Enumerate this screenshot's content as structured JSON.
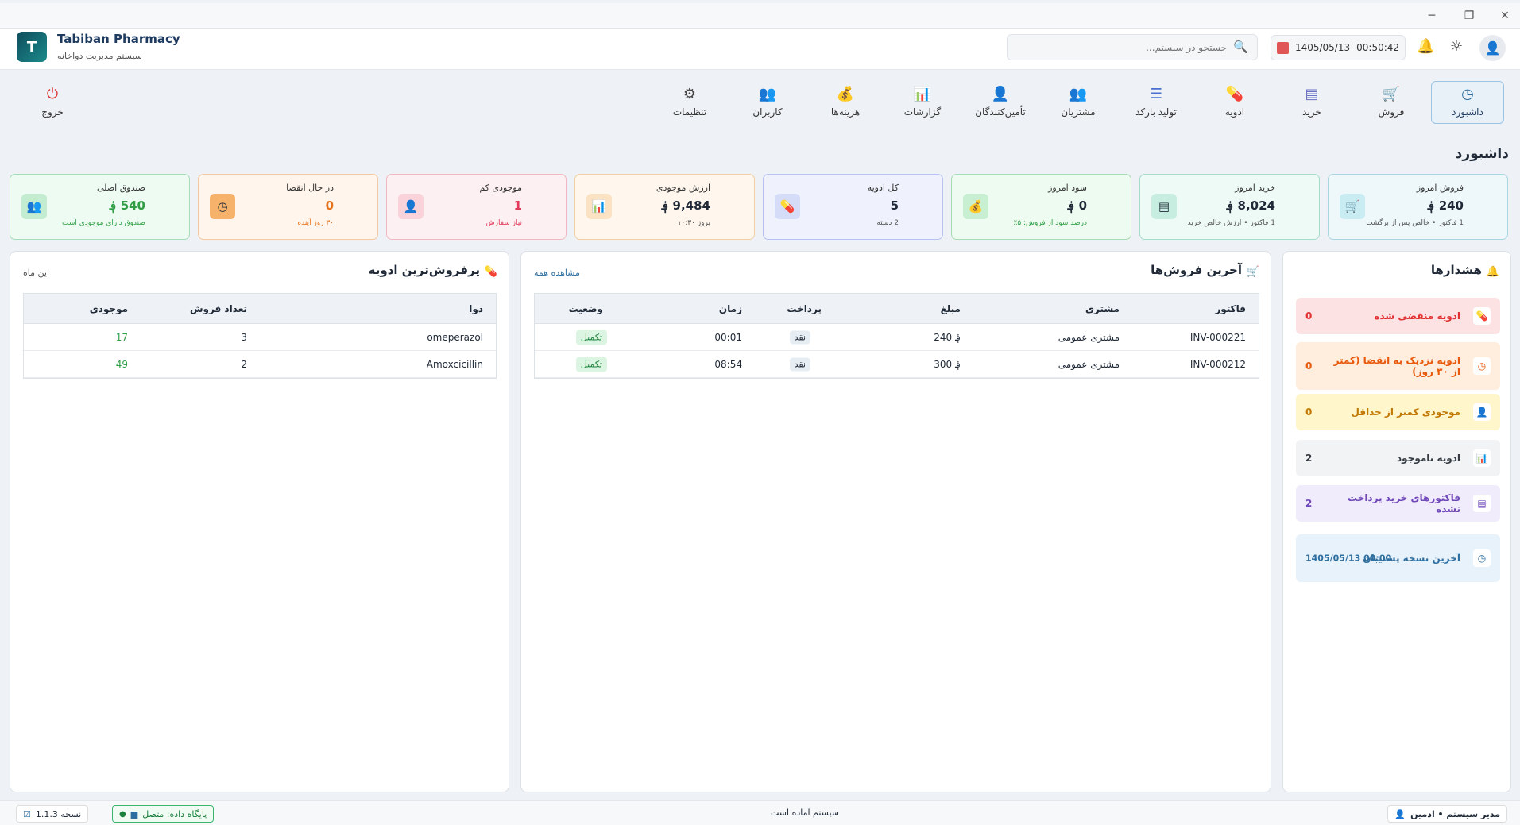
{
  "window": {
    "minimize": "─",
    "maximize": "❐",
    "close": "✕"
  },
  "header": {
    "app_name": "Tabiban Pharmacy",
    "app_subtitle": "سیستم مدیریت دواخانه",
    "logo_letter": "T",
    "search_placeholder": "جستجو در سیستم...",
    "date": "1405/05/13",
    "time": "00:50:42"
  },
  "nav": [
    {
      "label": "داشبورد",
      "icon": "clock-icon",
      "glyph": "◷",
      "color": "#2f6f9f"
    },
    {
      "label": "فروش",
      "icon": "cart-icon",
      "glyph": "🛒",
      "color": "#138a9a"
    },
    {
      "label": "خرید",
      "icon": "receipt-icon",
      "glyph": "▤",
      "color": "#6b6fc5"
    },
    {
      "label": "ادویه",
      "icon": "pill-icon",
      "glyph": "💊",
      "color": "#e0457b"
    },
    {
      "label": "تولید بارکد",
      "icon": "list-icon",
      "glyph": "☰",
      "color": "#4a6fd1"
    },
    {
      "label": "مشتریان",
      "icon": "users-icon",
      "glyph": "👥",
      "color": "#c97a1e"
    },
    {
      "label": "تأمین‌کنندگان",
      "icon": "supplier-icon",
      "glyph": "👤",
      "color": "#1e6fb3"
    },
    {
      "label": "گزارشات",
      "icon": "chart-icon",
      "glyph": "📊",
      "color": "#2a9ad8"
    },
    {
      "label": "هزینه‌ها",
      "icon": "money-bag-icon",
      "glyph": "💰",
      "color": "#2f9e44"
    },
    {
      "label": "کاربران",
      "icon": "group-icon",
      "glyph": "👥",
      "color": "#c97a1e"
    },
    {
      "label": "تنظیمات",
      "icon": "gear-icon",
      "glyph": "⚙",
      "color": "#444"
    },
    {
      "label": "خروج",
      "icon": "power-icon",
      "glyph": "⏻",
      "color": "#e03131"
    }
  ],
  "page_title": "داشبورد",
  "cards": [
    {
      "title": "فروش امروز",
      "value": "240 ؋",
      "sub": "1 فاکتور • خالص پس از برگشت",
      "icon": "cart-icon",
      "glyph": "🛒",
      "bg": "#eef8fb",
      "border": "#a9d6e0",
      "icon_bg": "#c9ebf2",
      "val_color": "#1f2937",
      "sub_color": "#555"
    },
    {
      "title": "خرید امروز",
      "value": "8,024 ؋",
      "sub": "1 فاکتور • ارزش خالص خرید",
      "icon": "receipt-icon",
      "glyph": "▤",
      "bg": "#eefaf6",
      "border": "#a5dcc8",
      "icon_bg": "#c7ede0",
      "val_color": "#1f2937",
      "sub_color": "#555"
    },
    {
      "title": "سود امروز",
      "value": "0 ؋",
      "sub": "درصد سود از فروش: ۵٪",
      "icon": "money-bag-icon",
      "glyph": "💰",
      "bg": "#eefbf1",
      "border": "#a6dcb3",
      "icon_bg": "#c9efd2",
      "val_color": "#1f2937",
      "sub_color": "#2f9e44"
    },
    {
      "title": "کل ادویه",
      "value": "5",
      "sub": "2 دسته",
      "icon": "pill-icon",
      "glyph": "💊",
      "bg": "#eff2fd",
      "border": "#b5c1f0",
      "icon_bg": "#d5dcf8",
      "val_color": "#1f2937",
      "sub_color": "#555"
    },
    {
      "title": "ارزش موجودی",
      "value": "9,484 ؋",
      "sub": "بروز ۱۰:۳۰",
      "icon": "chart-icon",
      "glyph": "📊",
      "bg": "#fff7ee",
      "border": "#f1cfa3",
      "icon_bg": "#fbe2c3",
      "val_color": "#1f2937",
      "sub_color": "#555"
    },
    {
      "title": "موجودی کم",
      "value": "1",
      "sub": "نیاز سفارش",
      "icon": "user-alert-icon",
      "glyph": "👤",
      "bg": "#fdf0f2",
      "border": "#f2b8c1",
      "icon_bg": "#f9d3d9",
      "val_color": "#e03a5a",
      "sub_color": "#e03a5a"
    },
    {
      "title": "در حال انقضا",
      "value": "0",
      "sub": "۳۰ روز آینده",
      "icon": "clock-icon",
      "glyph": "◷",
      "bg": "#fff5ec",
      "border": "#f3c9a0",
      "icon_bg": "#f6b26b",
      "val_color": "#e8731a",
      "sub_color": "#e8731a"
    },
    {
      "title": "صندوق اصلی",
      "value": "540 ؋",
      "sub": "صندوق دارای موجودی است",
      "icon": "safe-icon",
      "glyph": "👥",
      "bg": "#edfbf2",
      "border": "#a6dcb7",
      "icon_bg": "#c3ecd0",
      "val_color": "#2f9e44",
      "sub_color": "#2f9e44"
    }
  ],
  "alerts": {
    "title": "هشدارها",
    "bell": "🔔",
    "items": [
      {
        "label": "ادویه منقضی شده",
        "count": "0",
        "icon": "pill-icon",
        "glyph": "💊",
        "bg": "#fde2e4",
        "color": "#e03131"
      },
      {
        "label": "ادویه نزدیک به انقضا (کمتر از ۳۰ روز)",
        "count": "0",
        "icon": "clock-icon",
        "glyph": "◷",
        "bg": "#ffeedd",
        "color": "#e8590c"
      },
      {
        "label": "موجودی کمتر از حداقل",
        "count": "0",
        "icon": "user-alert-icon",
        "glyph": "👤",
        "bg": "#fff6cc",
        "color": "#c27803"
      },
      {
        "label": "ادویه ناموجود",
        "count": "2",
        "icon": "chart-icon",
        "glyph": "📊",
        "bg": "#f1f3f5",
        "color": "#343a40"
      },
      {
        "label": "فاکتورهای خرید پرداخت نشده",
        "count": "2",
        "icon": "receipt-icon",
        "glyph": "▤",
        "bg": "#f1ecfb",
        "color": "#7048b8"
      },
      {
        "label": "آخرین نسخه پشتیبان",
        "count": "00:00  1405/05/13",
        "icon": "clock-icon",
        "glyph": "◷",
        "bg": "#e8f2fb",
        "color": "#2f6f9f"
      }
    ]
  },
  "sales": {
    "title": "آخرین فروش‌ها",
    "icon": "cart-icon",
    "glyph": "🛒",
    "view_all": "مشاهده همه",
    "columns": {
      "invoice": "فاکتور",
      "customer": "مشتری",
      "amount": "مبلغ",
      "payment": "پرداخت",
      "time": "زمان",
      "status": "وضعیت"
    },
    "rows": [
      {
        "invoice": "INV-000221",
        "customer": "مشتری عمومی",
        "amount": "240 ؋",
        "payment": "نقد",
        "time": "00:01",
        "status": "تکمیل"
      },
      {
        "invoice": "INV-000212",
        "customer": "مشتری عمومی",
        "amount": "300 ؋",
        "payment": "نقد",
        "time": "08:54",
        "status": "تکمیل"
      }
    ]
  },
  "top": {
    "title": "پرفروش‌ترین ادویه",
    "icon": "pill-icon",
    "glyph": "💊",
    "period": "این ماه",
    "columns": {
      "drug": "دوا",
      "sold": "تعداد فروش",
      "stock": "موجودی"
    },
    "rows": [
      {
        "drug": "omeperazol",
        "sold": "3",
        "stock": "17"
      },
      {
        "drug": "Amoxcicillin",
        "sold": "2",
        "stock": "49"
      }
    ]
  },
  "status": {
    "user": "مدیر سیستم • ادمین",
    "message": "سیستم آماده است",
    "db": "پایگاه داده: متصل",
    "version": "نسخه 1.1.3"
  }
}
